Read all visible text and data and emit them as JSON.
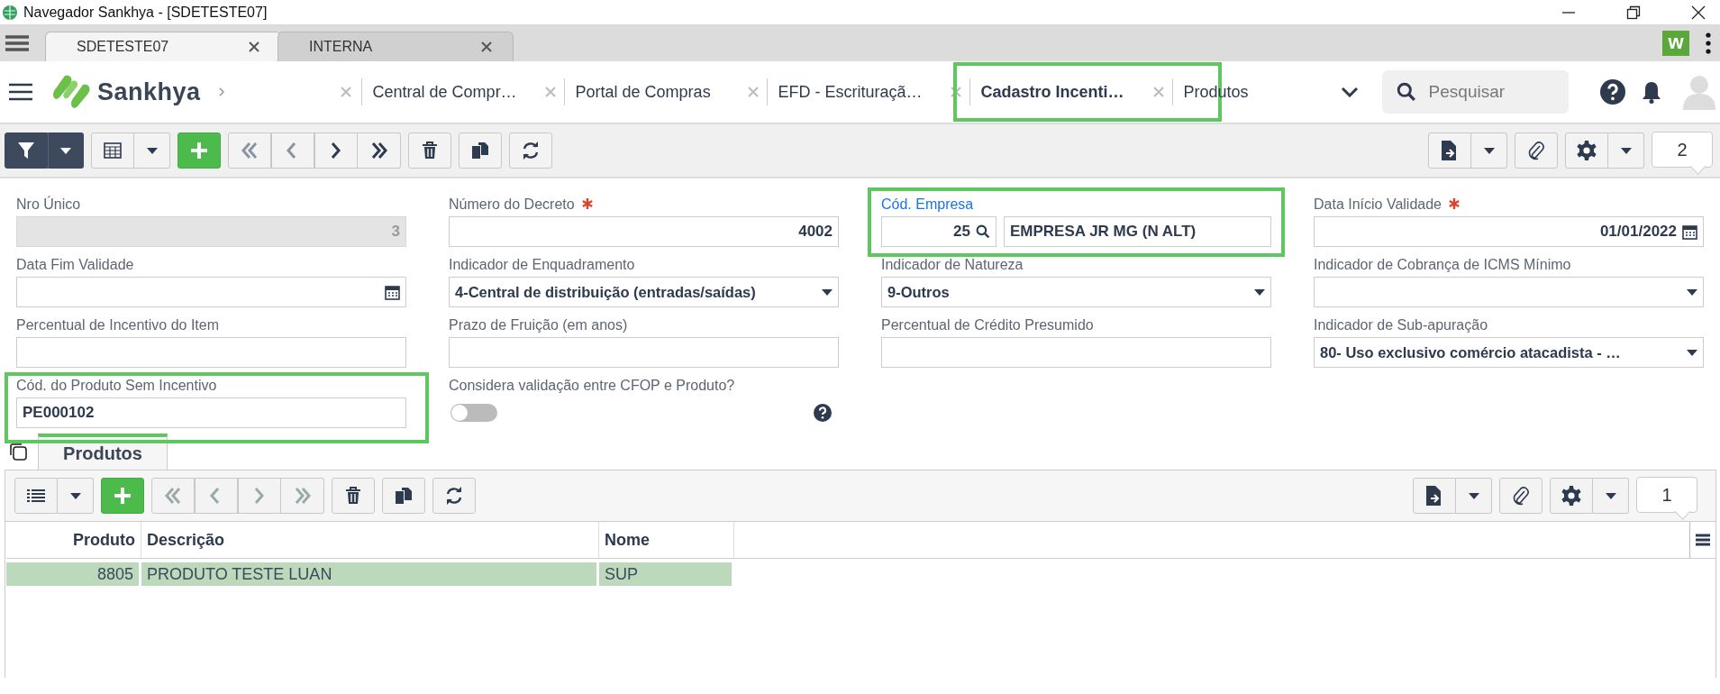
{
  "window": {
    "title": "Navegador Sankhya - [SDETESTE07]"
  },
  "browser_tabs": [
    {
      "label": "SDETESTE07",
      "selected": true
    },
    {
      "label": "INTERNA",
      "selected": false
    }
  ],
  "extension_badge": "w",
  "app_header": {
    "brand": "Sankhya",
    "tabs": [
      {
        "label": "Central de Compr…",
        "selected": false,
        "highlighted": false,
        "closable": true
      },
      {
        "label": "Portal de Compras",
        "selected": false,
        "highlighted": false,
        "closable": true
      },
      {
        "label": "EFD - Escrituraçã…",
        "selected": false,
        "highlighted": false,
        "closable": true
      },
      {
        "label": "Cadastro Incenti…",
        "selected": true,
        "highlighted": true,
        "closable": true
      },
      {
        "label": "Produtos",
        "selected": false,
        "highlighted": false,
        "closable": false
      }
    ],
    "search": {
      "placeholder": "Pesquisar"
    }
  },
  "toolbar": {
    "record_count": "2"
  },
  "form": {
    "fields": [
      {
        "label": "Nro Único",
        "kind": "number",
        "value": "3",
        "required": false,
        "disabled": true,
        "highlighted": false,
        "link": false
      },
      {
        "label": "Número do Decreto",
        "kind": "number",
        "value": "4002",
        "required": true,
        "disabled": false,
        "highlighted": false,
        "link": false
      },
      {
        "label": "Cód. Empresa",
        "kind": "lookup",
        "code": "25",
        "description": "EMPRESA JR MG (N ALT)",
        "required": false,
        "disabled": false,
        "highlighted": true,
        "link": true
      },
      {
        "label": "Data Início Validade",
        "kind": "date",
        "value": "01/01/2022",
        "required": true,
        "disabled": false,
        "highlighted": false,
        "link": false
      },
      {
        "label": "Data Fim Validade",
        "kind": "date",
        "required": false,
        "disabled": false,
        "highlighted": false,
        "link": false
      },
      {
        "label": "Indicador de Enquadramento",
        "kind": "select",
        "value": "4-Central de distribuição (entradas/saídas)",
        "required": false,
        "disabled": false,
        "highlighted": false,
        "link": false
      },
      {
        "label": "Indicador de Natureza",
        "kind": "select",
        "value": "9-Outros",
        "required": false,
        "disabled": false,
        "highlighted": false,
        "link": false
      },
      {
        "label": "Indicador de Cobrança de ICMS Mínimo",
        "kind": "select",
        "required": false,
        "disabled": false,
        "highlighted": false,
        "link": false
      },
      {
        "label": "Percentual de Incentivo do Item",
        "kind": "text",
        "required": false,
        "disabled": false,
        "highlighted": false,
        "link": false
      },
      {
        "label": "Prazo de Fruição (em anos)",
        "kind": "text",
        "required": false,
        "disabled": false,
        "highlighted": false,
        "link": false
      },
      {
        "label": "Percentual de Crédito Presumido",
        "kind": "text",
        "required": false,
        "disabled": false,
        "highlighted": false,
        "link": false
      },
      {
        "label": "Indicador de Sub-apuração",
        "kind": "select",
        "value": "80- Uso exclusivo comércio atacadista - …",
        "required": false,
        "disabled": false,
        "highlighted": false,
        "link": false
      },
      {
        "label": "Cód. do Produto Sem Incentivo",
        "kind": "text",
        "value": "PE000102",
        "required": false,
        "disabled": false,
        "highlighted": true,
        "link": false
      },
      {
        "label": "Considera validação entre CFOP e Produto?",
        "kind": "toggle",
        "on": false,
        "required": false,
        "disabled": false,
        "highlighted": false,
        "link": false
      }
    ]
  },
  "detail": {
    "tabs": [
      {
        "label": "Produtos",
        "selected": true
      }
    ],
    "toolbar": {
      "record_count": "1"
    },
    "table": {
      "columns": [
        {
          "label": "Produto",
          "kind": "number"
        },
        {
          "label": "Descrição",
          "kind": "text"
        },
        {
          "label": "Nome",
          "kind": "text"
        }
      ],
      "rows": [
        {
          "cells": [
            "8805",
            "PRODUTO TESTE LUAN",
            "SUP"
          ],
          "selected": true
        }
      ]
    }
  }
}
